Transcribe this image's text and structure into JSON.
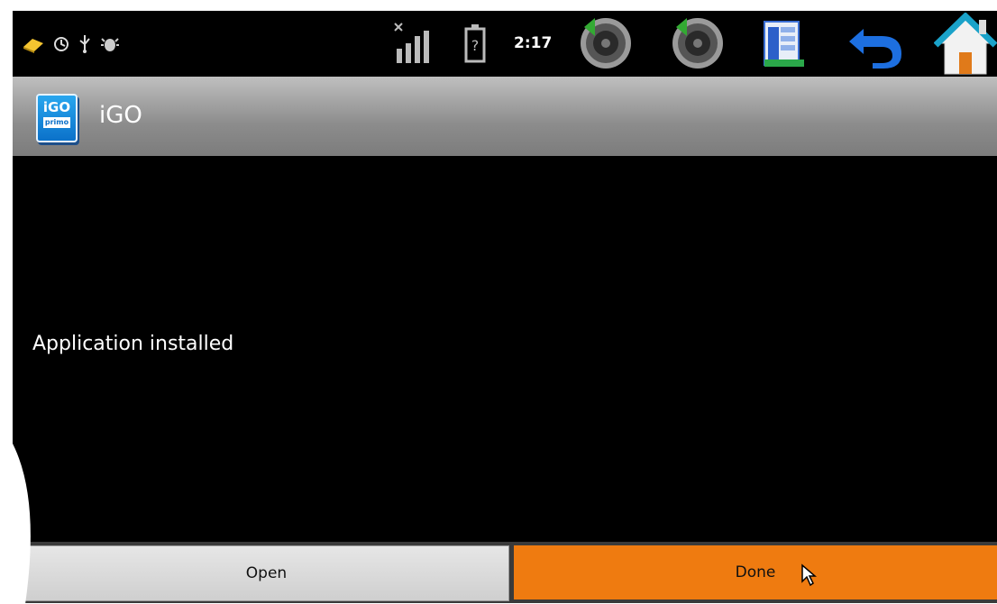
{
  "statusbar": {
    "time": "2:17",
    "icons": [
      "notification-icon",
      "sync-icon",
      "usb-icon",
      "android-debug-icon",
      "signal-icon",
      "battery-unknown-icon",
      "volume-down-icon",
      "volume-up-icon",
      "menu-icon",
      "back-icon",
      "home-icon"
    ]
  },
  "app": {
    "title": "iGO",
    "icon_line1": "iGO",
    "icon_line2": "primo"
  },
  "content": {
    "message": "Application installed"
  },
  "buttons": {
    "open_label": "Open",
    "done_label": "Done"
  },
  "colors": {
    "accent": "#ef7b10",
    "titlebar": "#8c8c8c",
    "background": "#000000"
  }
}
